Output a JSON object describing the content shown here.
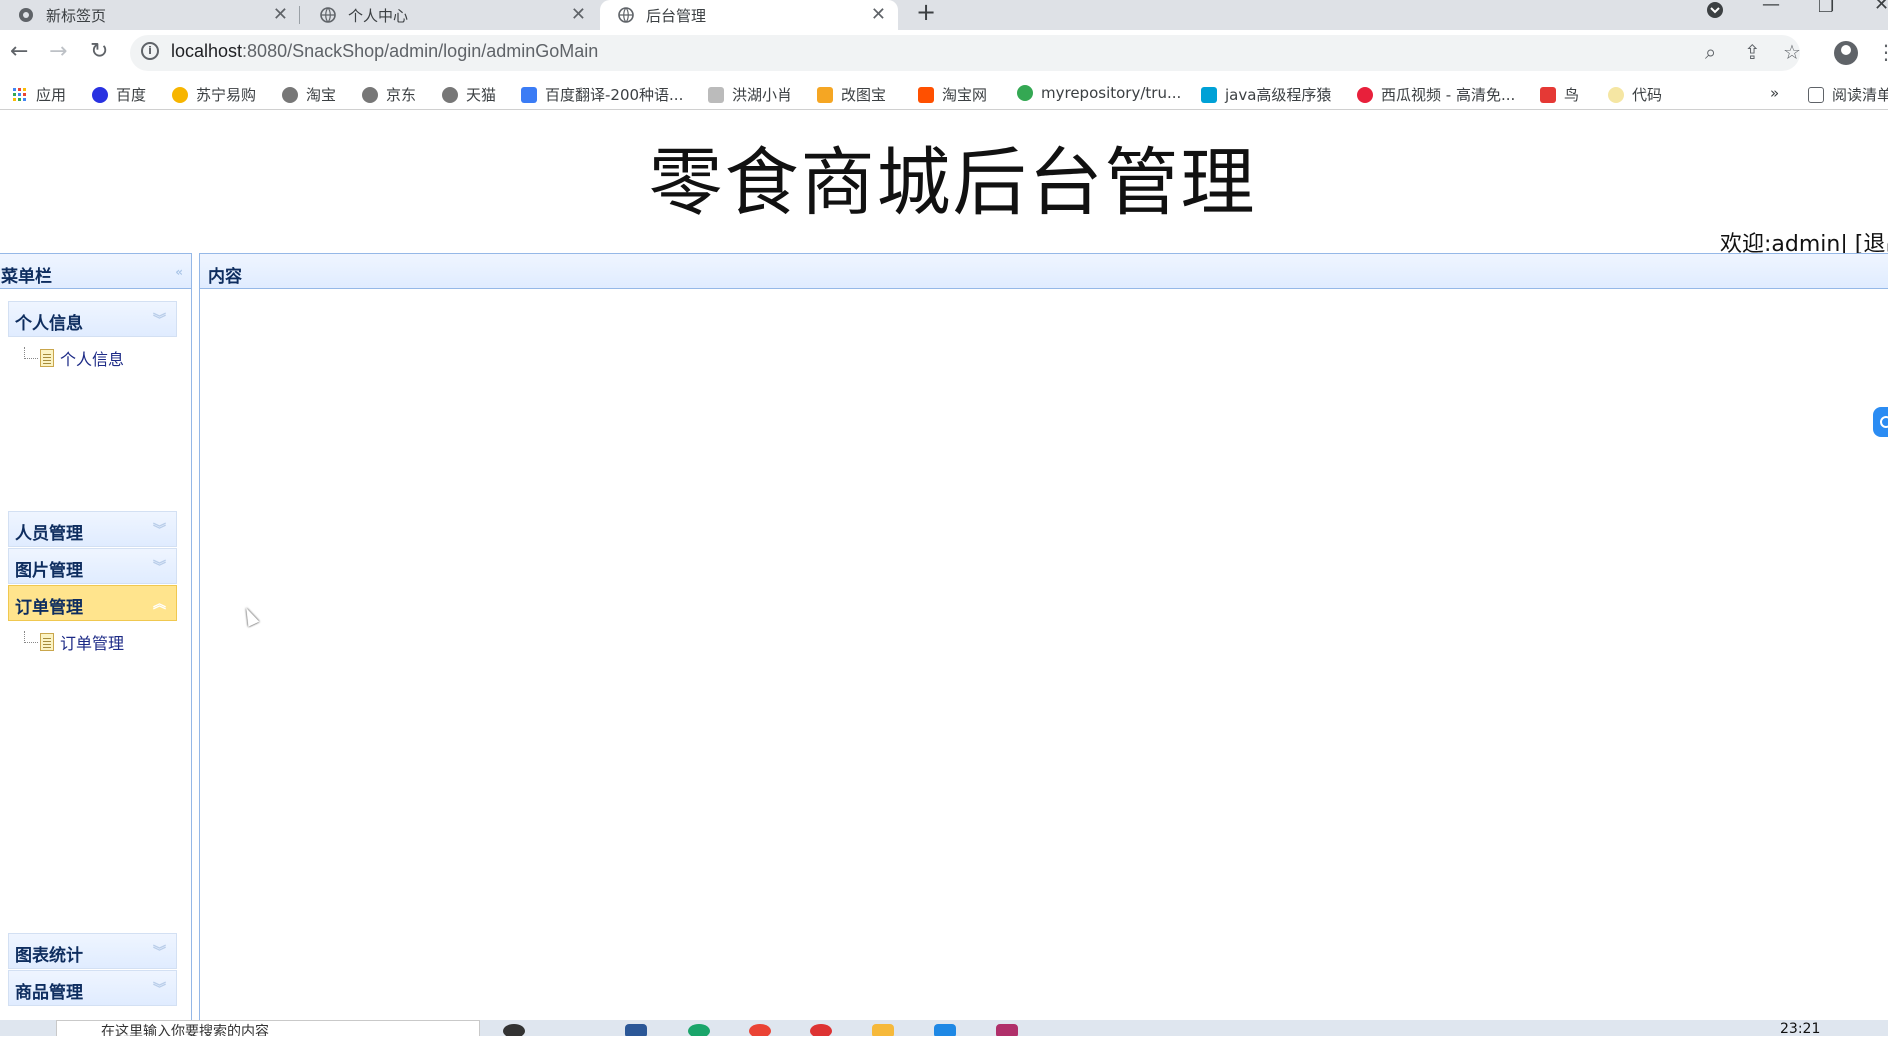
{
  "browser": {
    "tabs": [
      {
        "title": "新标签页",
        "active": false
      },
      {
        "title": "个人中心",
        "active": false
      },
      {
        "title": "后台管理",
        "active": true
      }
    ],
    "url_host": "localhost",
    "url_path": ":8080/SnackShop/admin/login/adminGoMain",
    "bookmarks": [
      {
        "label": "应用",
        "color": "#4285f4"
      },
      {
        "label": "百度",
        "color": "#2932e1"
      },
      {
        "label": "苏宁易购",
        "color": "#f7b500"
      },
      {
        "label": "淘宝",
        "color": "#777777"
      },
      {
        "label": "京东",
        "color": "#777777"
      },
      {
        "label": "天猫",
        "color": "#777777"
      },
      {
        "label": "百度翻译-200种语...",
        "color": "#3b7cf5"
      },
      {
        "label": "洪湖小肖",
        "color": "#888888"
      },
      {
        "label": "改图宝",
        "color": "#f5a623"
      },
      {
        "label": "淘宝网",
        "color": "#ff5000"
      },
      {
        "label": "myrepository/tru...",
        "color": "#34a853"
      },
      {
        "label": "java高级程序猿",
        "color": "#00a1d6"
      },
      {
        "label": "西瓜视频 - 高清免...",
        "color": "#e8203b"
      },
      {
        "label": "鸟",
        "color": "#e53935"
      },
      {
        "label": "代码",
        "color": "#f5e6a3"
      }
    ],
    "bookmarks_more": "»",
    "reading_list": "阅读清单"
  },
  "page": {
    "title": "零食商城后台管理",
    "welcome": "欢迎:admin| [退出]"
  },
  "menu": {
    "header": "菜单栏",
    "sections": [
      {
        "label": "个人信息",
        "open": false,
        "items": [
          "个人信息"
        ]
      },
      {
        "label": "人员管理",
        "open": false,
        "items": []
      },
      {
        "label": "图片管理",
        "open": false,
        "items": []
      },
      {
        "label": "订单管理",
        "open": true,
        "items": [
          "订单管理"
        ]
      },
      {
        "label": "图表统计",
        "open": false,
        "items": []
      },
      {
        "label": "商品管理",
        "open": false,
        "items": []
      }
    ]
  },
  "content": {
    "header": "内容"
  },
  "taskbar": {
    "search_placeholder": "在这里输入你要搜索的内容",
    "time": "23:21"
  }
}
